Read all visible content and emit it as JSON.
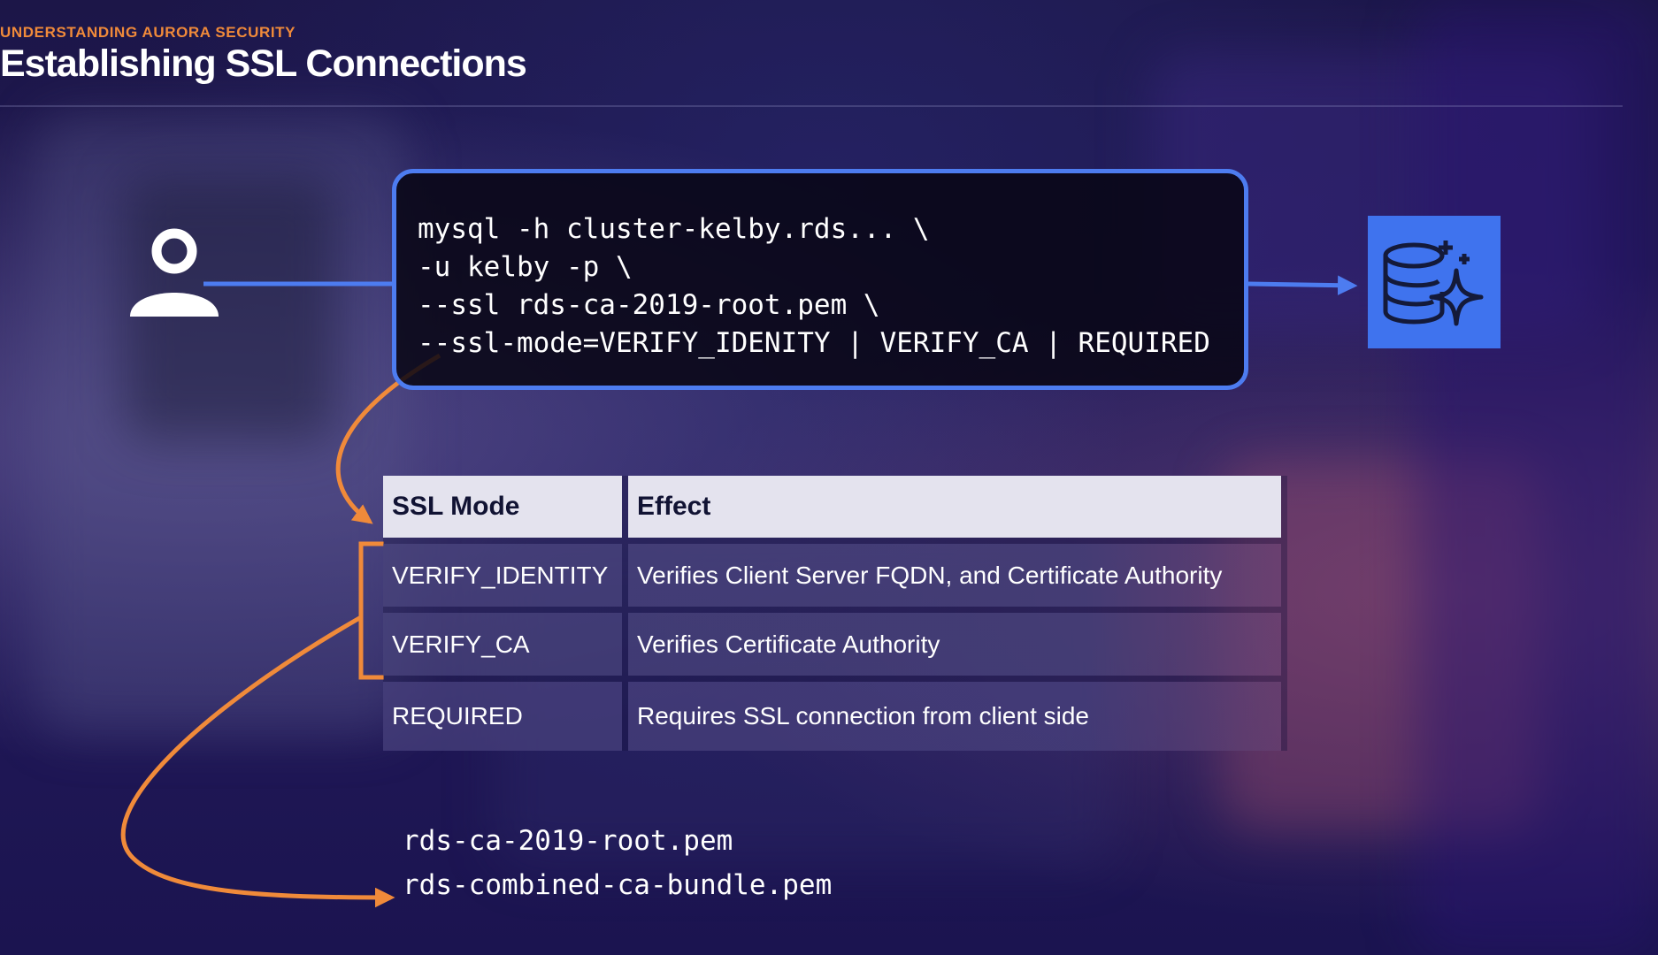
{
  "header": {
    "eyebrow": "UNDERSTANDING AURORA SECURITY",
    "title": "Establishing SSL Connections"
  },
  "command": {
    "lines": [
      "mysql -h cluster-kelby.rds... \\",
      "-u kelby -p \\",
      "--ssl rds-ca-2019-root.pem \\",
      "--ssl-mode=VERIFY_IDENITY | VERIFY_CA | REQUIRED"
    ]
  },
  "icons": {
    "user": "user-icon",
    "database": "aurora-database-icon"
  },
  "table": {
    "headers": [
      "SSL Mode",
      "Effect"
    ],
    "rows": [
      [
        "VERIFY_IDENTITY",
        "Verifies Client Server FQDN, and Certificate Authority"
      ],
      [
        "VERIFY_CA",
        "Verifies Certificate Authority"
      ],
      [
        "REQUIRED",
        "Requires SSL connection from client side"
      ]
    ]
  },
  "files": [
    "rds-ca-2019-root.pem",
    "rds-combined-ca-bundle.pem"
  ],
  "colors": {
    "accent_orange": "#f08a3a",
    "accent_blue": "#4d7cf0",
    "database_blue": "#3f73ee"
  }
}
